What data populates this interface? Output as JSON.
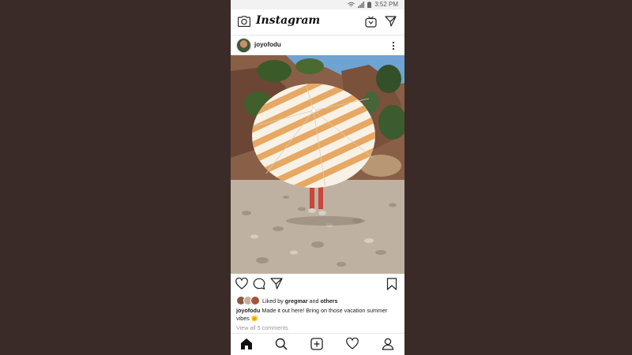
{
  "status_bar": {
    "time": "3:52 PM",
    "icons": [
      "wifi-icon",
      "signal-icon",
      "battery-icon"
    ]
  },
  "header": {
    "brand": "Instagram",
    "icons": [
      "camera-icon",
      "igtv-icon",
      "send-icon"
    ]
  },
  "post": {
    "username": "joyofodu",
    "photo_icon": "umbrella-photo",
    "actions": [
      "heart-icon",
      "comment-icon",
      "share-icon",
      "bookmark-icon"
    ],
    "liked_by_prefix": "Liked by",
    "liked_by_user": "gregmar",
    "liked_by_and": "and",
    "liked_by_others": "others",
    "caption_user": "joyofodu",
    "caption_text": "Made it out here! Bring on those vacation summer vibes 🌞",
    "view_comments": "View all 5 comments"
  },
  "bottom_nav": [
    "home-icon",
    "search-icon",
    "add-post-icon",
    "activity-heart-icon",
    "profile-icon"
  ],
  "colors": {
    "background": "#3a2b28",
    "text": "#222222",
    "muted": "#999999",
    "stripe": "#e7a863"
  }
}
